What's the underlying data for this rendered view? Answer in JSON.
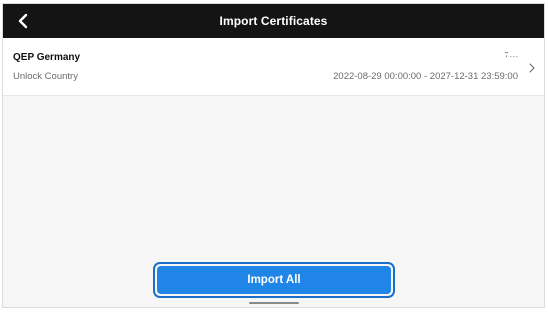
{
  "header": {
    "title": "Import Certificates",
    "back_icon": "chevron-left-icon"
  },
  "certificate": {
    "name": "QEP Germany",
    "type": "Unlock Country",
    "date_range": "2022-08-29 00:00:00 - 2027-12-31 23:59:00",
    "location_icon": "location-pin-icon",
    "arrow_icon": "chevron-right-icon"
  },
  "footer": {
    "import_all_label": "Import All"
  },
  "colors": {
    "header_bg": "#141414",
    "accent": "#1f86e8",
    "focus_ring": "#1a6fc8",
    "page_bg": "#f6f6f6"
  }
}
